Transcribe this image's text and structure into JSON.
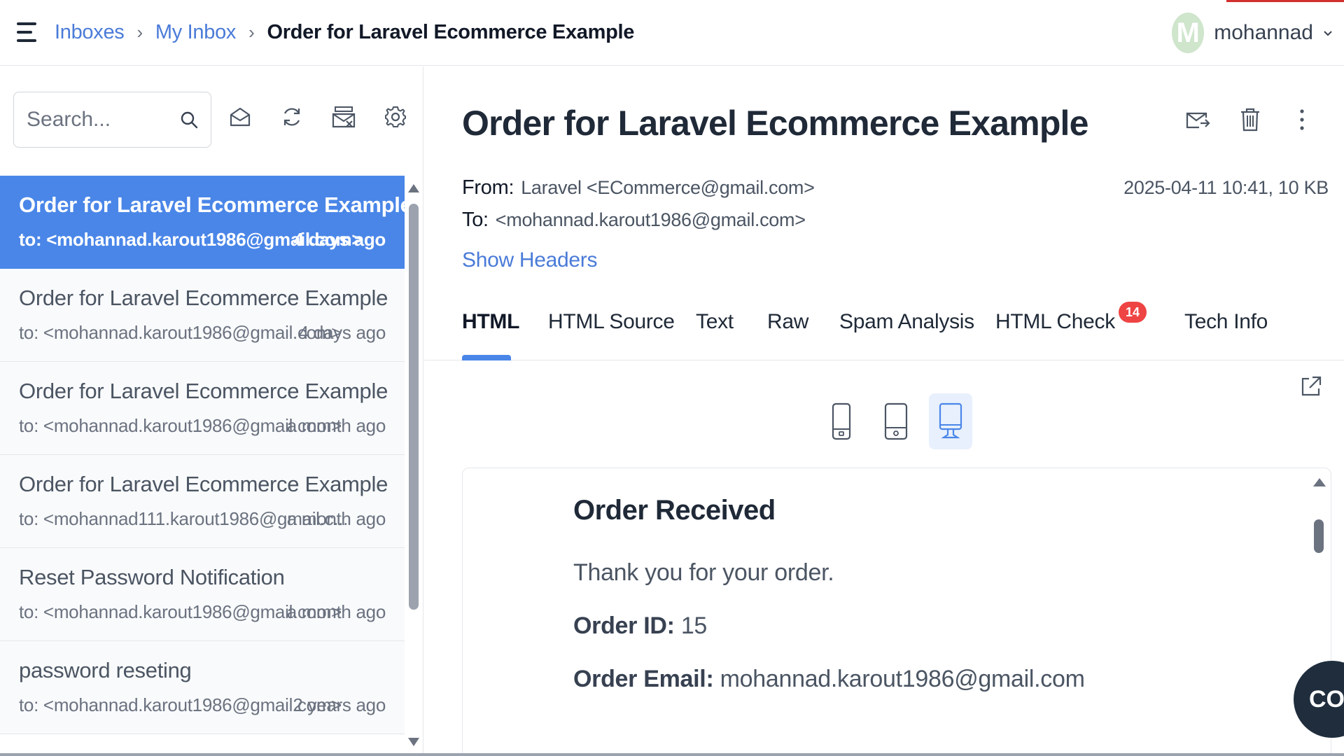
{
  "breadcrumb": {
    "inboxes": "Inboxes",
    "sep1": "›",
    "my_inbox": "My Inbox",
    "sep2": "›",
    "current": "Order for Laravel Ecommerce Example"
  },
  "user": {
    "initial": "M",
    "name": "mohannad"
  },
  "search": {
    "placeholder": "Search..."
  },
  "toolbar_icons": [
    "mark-read-icon",
    "refresh-icon",
    "clear-inbox-icon",
    "settings-icon"
  ],
  "messages": [
    {
      "subject": "Order for Laravel Ecommerce Example",
      "to": "to: <mohannad.karout1986@gmail.com>",
      "when": "4 days ago",
      "active": true
    },
    {
      "subject": "Order for Laravel Ecommerce Example",
      "to": "to: <mohannad.karout1986@gmail.com>",
      "when": "4 days ago",
      "active": false
    },
    {
      "subject": "Order for Laravel Ecommerce Example",
      "to": "to: <mohannad.karout1986@gmail.com>",
      "when": "a month ago",
      "active": false
    },
    {
      "subject": "Order for Laravel Ecommerce Example",
      "to": "to: <mohannad111.karout1986@gmail.c...",
      "when": "a month ago",
      "active": false
    },
    {
      "subject": "Reset Password Notification",
      "to": "to: <mohannad.karout1986@gmail.com>",
      "when": "a month ago",
      "active": false
    },
    {
      "subject": "password reseting",
      "to": "to: <mohannad.karout1986@gmail.com>",
      "when": "2 years ago",
      "active": false
    }
  ],
  "message": {
    "title": "Order for Laravel Ecommerce Example",
    "from_label": "From:",
    "from_value": "Laravel <ECommerce@gmail.com>",
    "to_label": "To:",
    "to_value": "<mohannad.karout1986@gmail.com>",
    "date_size": "2025-04-11 10:41, 10 KB",
    "show_headers": "Show Headers"
  },
  "tabs": [
    {
      "label": "HTML",
      "active": true
    },
    {
      "label": "HTML Source",
      "active": false
    },
    {
      "label": "Text",
      "active": false
    },
    {
      "label": "Raw",
      "active": false
    },
    {
      "label": "Spam Analysis",
      "active": false
    },
    {
      "label": "HTML Check",
      "active": false,
      "badge": "14"
    },
    {
      "label": "Tech Info",
      "active": false
    }
  ],
  "preview": {
    "heading": "Order Received",
    "thanks": "Thank you for your order.",
    "order_id_label": "Order ID:",
    "order_id_value": "15",
    "order_email_label": "Order Email:",
    "order_email_value": "mohannad.karout1986@gmail.com"
  },
  "fab": {
    "label": "CO"
  },
  "colors": {
    "accent": "#4a86e8",
    "link": "#4a7bd8",
    "badge": "#ef4444",
    "fab": "#1f2d3d"
  }
}
